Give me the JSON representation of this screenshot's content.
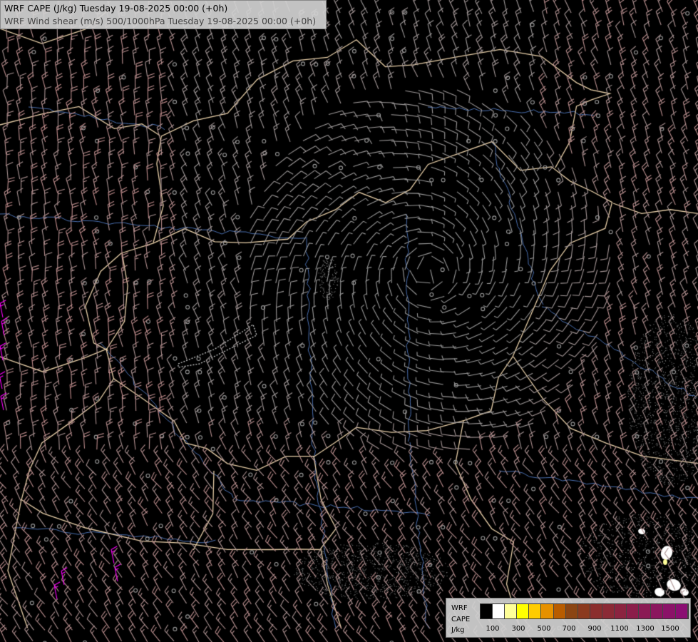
{
  "titles": {
    "line1": "WRF CAPE (J/kg) Tuesday 19-08-2025 00:00 (+0h)",
    "line2": "WRF Wind shear (m/s) 500/1000hPa Tuesday 19-08-2025 00:00 (+0h)"
  },
  "legend": {
    "label_lines": [
      "WRF",
      "CAPE",
      "J/kg"
    ],
    "colors": [
      "#000000",
      "#ffffff",
      "#ffff99",
      "#ffff00",
      "#ffcc00",
      "#e69100",
      "#b85c00",
      "#8b4513",
      "#8b3a1e",
      "#8b2e2e",
      "#8b2a36",
      "#8b2440",
      "#8b1e4a",
      "#8b1a54",
      "#8b165e",
      "#8b1268",
      "#8b0e72"
    ],
    "ticks": [
      "100",
      "300",
      "500",
      "700",
      "900",
      "1100",
      "1300",
      "1500"
    ]
  },
  "colors": {
    "background": "#000000",
    "border_lines": "#e8cfa8",
    "rivers": "#4a6fb0",
    "barb_weak": "#9a9a9a",
    "barb_strong": "#c88a8a",
    "cape_high": "#ff00ff"
  }
}
